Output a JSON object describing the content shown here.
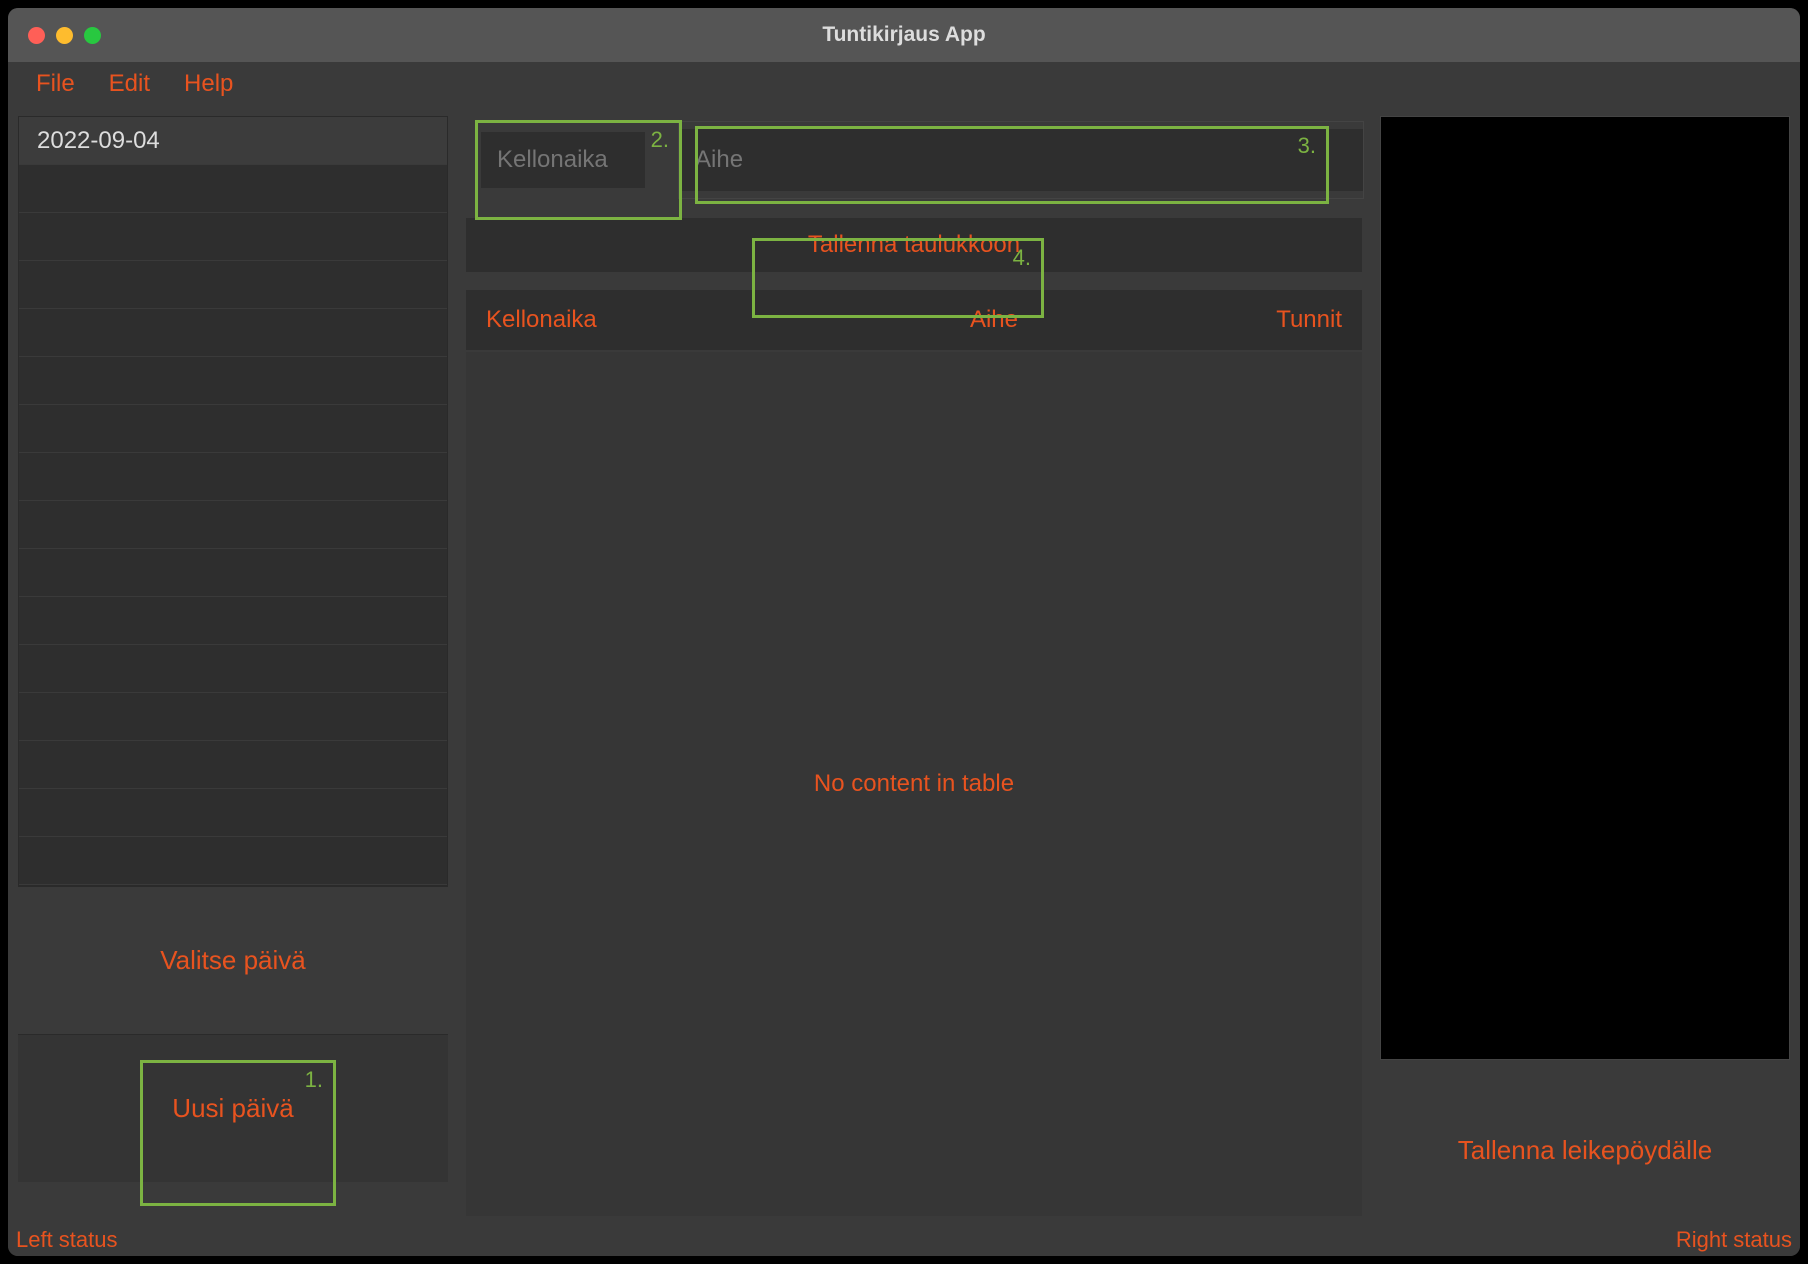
{
  "window": {
    "title": "Tuntikirjaus App"
  },
  "menu": {
    "file": "File",
    "edit": "Edit",
    "help": "Help"
  },
  "sidebar": {
    "days": [
      "2022-09-04",
      "",
      "",
      "",
      "",
      "",
      "",
      "",
      "",
      "",
      "",
      "",
      "",
      "",
      "",
      ""
    ],
    "select_day_label": "Valitse päivä",
    "new_day_label": "Uusi päivä"
  },
  "inputs": {
    "time_placeholder": "Kellonaika",
    "subject_placeholder": "Aihe",
    "save_button_label": "Tallenna taulukkoon"
  },
  "table": {
    "headers": {
      "time": "Kellonaika",
      "subject": "Aihe",
      "hours": "Tunnit"
    },
    "empty_message": "No content in table"
  },
  "right": {
    "clipboard_label": "Tallenna leikepöydälle"
  },
  "status": {
    "left": "Left status",
    "right": "Right status"
  },
  "annotations": {
    "n1": "1.",
    "n2": "2.",
    "n3": "3.",
    "n4": "4."
  }
}
